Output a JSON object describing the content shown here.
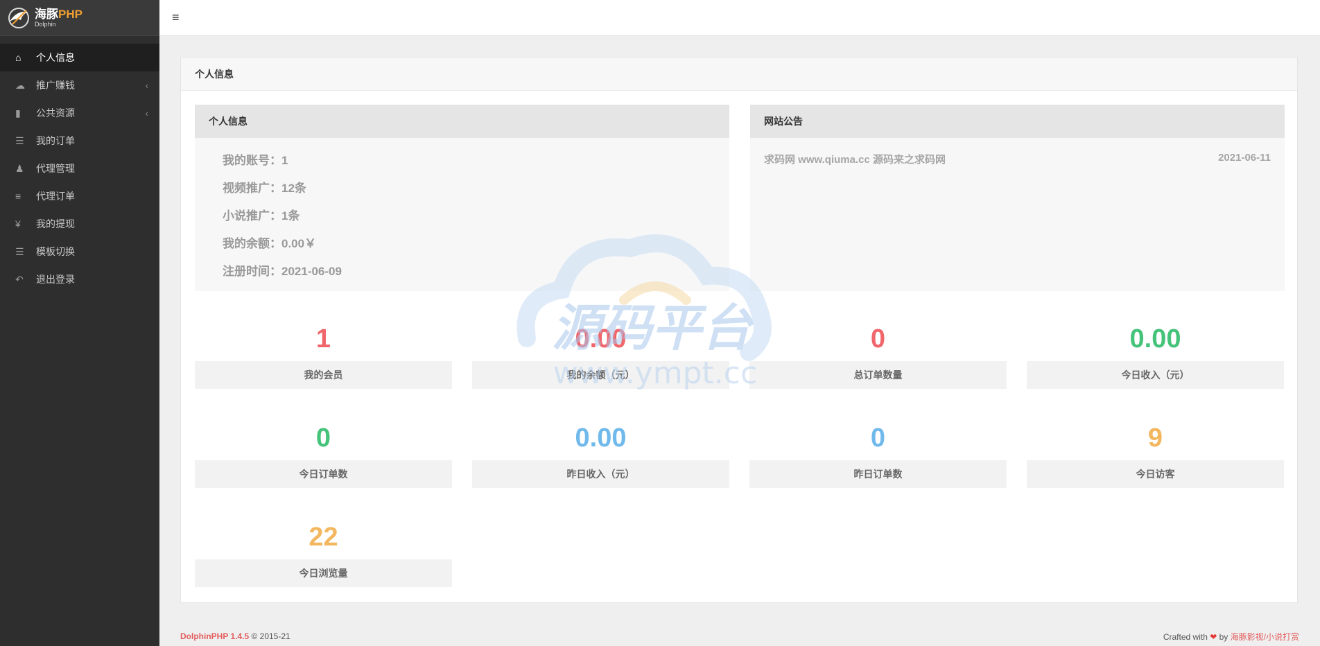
{
  "brand": {
    "name_cn": "海豚",
    "name_php": "PHP",
    "sub": "Dolphin"
  },
  "sidebar": {
    "items": [
      {
        "label": "个人信息",
        "icon": "home-icon",
        "active": true,
        "has_children": false
      },
      {
        "label": "推广赚钱",
        "icon": "cloud-icon",
        "active": false,
        "has_children": true
      },
      {
        "label": "公共资源",
        "icon": "video-camera-icon",
        "active": false,
        "has_children": true
      },
      {
        "label": "我的订单",
        "icon": "list-icon",
        "active": false,
        "has_children": false
      },
      {
        "label": "代理管理",
        "icon": "users-icon",
        "active": false,
        "has_children": false
      },
      {
        "label": "代理订单",
        "icon": "bars-icon",
        "active": false,
        "has_children": false
      },
      {
        "label": "我的提现",
        "icon": "yen-icon",
        "active": false,
        "has_children": false
      },
      {
        "label": "模板切换",
        "icon": "list-icon",
        "active": false,
        "has_children": false
      },
      {
        "label": "退出登录",
        "icon": "reply-icon",
        "active": false,
        "has_children": false
      }
    ]
  },
  "header": {
    "toggle_icon": "hamburger-icon"
  },
  "panel": {
    "title": "个人信息"
  },
  "profile": {
    "title": "个人信息",
    "rows": [
      "我的账号：1",
      "视频推广：12条",
      "小说推广：1条",
      "我的余额：0.00￥",
      "注册时间：2021-06-09"
    ]
  },
  "notice": {
    "title": "网站公告",
    "items": [
      {
        "text": "求码网 www.qiuma.cc 源码来之求码网",
        "date": "2021-06-11"
      }
    ]
  },
  "stats": [
    {
      "value": "1",
      "label": "我的会员",
      "color": "#f0666b"
    },
    {
      "value": "0.00",
      "label": "我的余额（元）",
      "color": "#f0666b"
    },
    {
      "value": "0",
      "label": "总订单数量",
      "color": "#f0666b"
    },
    {
      "value": "0.00",
      "label": "今日收入（元）",
      "color": "#46c37b"
    },
    {
      "value": "0",
      "label": "今日订单数",
      "color": "#46c37b"
    },
    {
      "value": "0.00",
      "label": "昨日收入（元）",
      "color": "#70b9eb"
    },
    {
      "value": "0",
      "label": "昨日订单数",
      "color": "#70b9eb"
    },
    {
      "value": "9",
      "label": "今日访客",
      "color": "#f3b760"
    },
    {
      "value": "22",
      "label": "今日浏览量",
      "color": "#f3b760"
    }
  ],
  "watermark": {
    "text_cn": "源码平台",
    "text_url": "www.ympt.cc"
  },
  "footer": {
    "brand": "DolphinPHP 1.4.5",
    "copyright": "© 2015-21",
    "crafted": "Crafted with",
    "by": "by",
    "link": "海豚影视/小说打赏"
  }
}
